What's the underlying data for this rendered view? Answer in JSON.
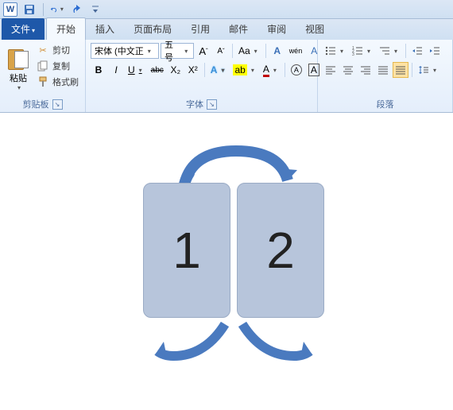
{
  "qat": {
    "app_letter": "W"
  },
  "tabs": {
    "file": "文件",
    "home": "开始",
    "insert": "插入",
    "layout": "页面布局",
    "references": "引用",
    "mail": "邮件",
    "review": "审阅",
    "view": "视图"
  },
  "clipboard": {
    "paste": "粘贴",
    "cut": "剪切",
    "copy": "复制",
    "format_painter": "格式刷",
    "group_label": "剪贴板"
  },
  "font": {
    "name": "宋体 (中文正",
    "size": "五号",
    "grow": "A",
    "shrink": "A",
    "change_case": "Aa",
    "clear_btn1": "A",
    "clear_btn2": "wén",
    "clear_fmt": "A",
    "bold": "B",
    "italic": "I",
    "underline": "U",
    "strike": "abc",
    "sub": "X₂",
    "sup": "X²",
    "effects": "A",
    "highlight": "ab",
    "color": "A",
    "circled": "A",
    "border": "A",
    "group_label": "字体"
  },
  "paragraph": {
    "group_label": "段落"
  },
  "diagram": {
    "left": "1",
    "right": "2"
  }
}
